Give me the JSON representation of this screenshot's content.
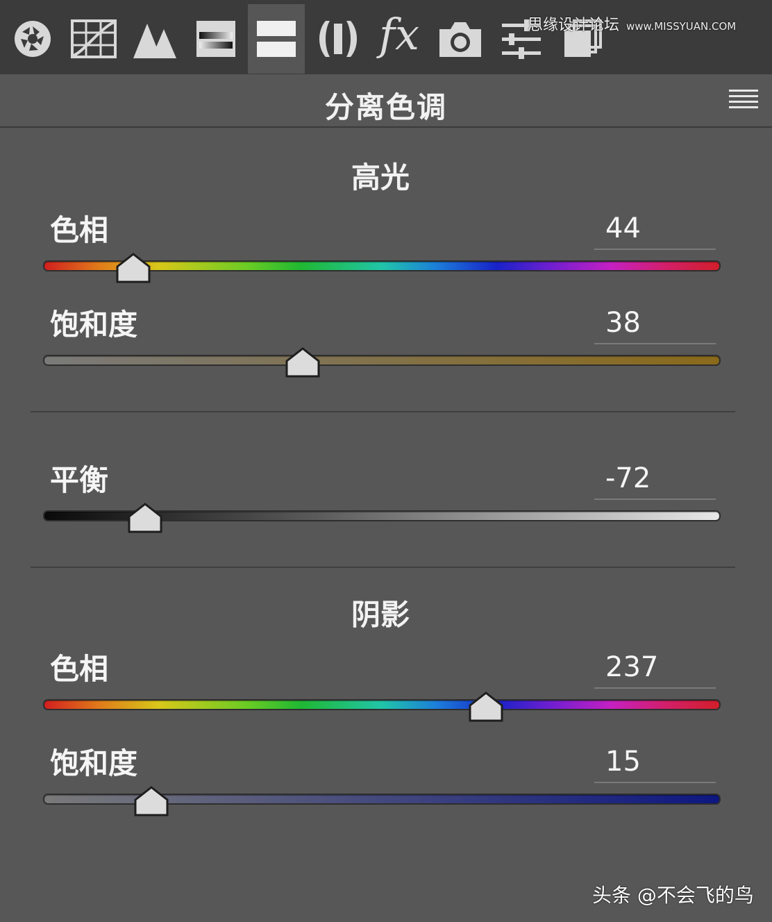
{
  "toolbar": {
    "tools": [
      {
        "icon": "aperture-icon"
      },
      {
        "icon": "tone-curve-icon"
      },
      {
        "icon": "detail-icon"
      },
      {
        "icon": "hsl-icon"
      },
      {
        "icon": "split-toning-icon",
        "active": true
      },
      {
        "icon": "lens-corrections-icon"
      },
      {
        "icon": "effects-fx-icon",
        "glyph": "fx"
      },
      {
        "icon": "camera-calibration-icon"
      },
      {
        "icon": "presets-sliders-icon"
      },
      {
        "icon": "snapshots-icon"
      }
    ]
  },
  "watermark": {
    "text": "思缘设计论坛",
    "site": "www.MISSYUAN.COM"
  },
  "panel": {
    "title": "分离色调"
  },
  "highlights": {
    "title": "高光",
    "hue": {
      "label": "色相",
      "value": "44",
      "min": 0,
      "max": 360,
      "level": 44
    },
    "saturation": {
      "label": "饱和度",
      "value": "38",
      "min": 0,
      "max": 100,
      "level": 38
    }
  },
  "balance": {
    "label": "平衡",
    "value": "-72",
    "min": -100,
    "max": 100,
    "level": -72
  },
  "shadows": {
    "title": "阴影",
    "hue": {
      "label": "色相",
      "value": "237",
      "min": 0,
      "max": 360,
      "level": 237
    },
    "saturation": {
      "label": "饱和度",
      "value": "15",
      "min": 0,
      "max": 100,
      "level": 15
    }
  },
  "colors": {
    "panel_bg": "#575757",
    "toolbar_bg": "#3b3b3b",
    "highlight_sat_color": "#8a6a1a",
    "shadow_sat_color": "#0d1780"
  },
  "footer": {
    "text": "头条 @不会飞的鸟"
  }
}
